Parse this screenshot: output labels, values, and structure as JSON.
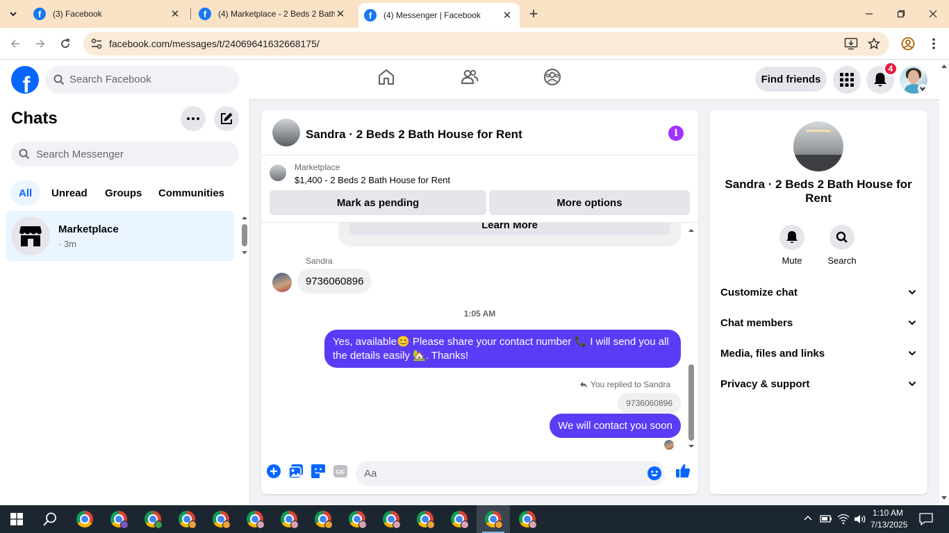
{
  "browser": {
    "tabs": [
      {
        "title": "(3) Facebook",
        "active": false
      },
      {
        "title": "(4) Marketplace - 2 Beds 2 Bath",
        "active": false
      },
      {
        "title": "(4) Messenger | Facebook",
        "active": true
      }
    ],
    "url": "facebook.com/messages/t/24069641632668175/"
  },
  "fb_header": {
    "logo": "f",
    "search_placeholder": "Search Facebook",
    "find_friends": "Find friends",
    "notifications_count": "4"
  },
  "chats": {
    "title": "Chats",
    "search_placeholder": "Search Messenger",
    "filters": [
      "All",
      "Unread",
      "Groups",
      "Communities"
    ],
    "active_filter": "All",
    "items": [
      {
        "name": "Marketplace",
        "time": "· 3m"
      }
    ]
  },
  "conversation": {
    "title": "Sandra · 2 Beds 2 Bath House for Rent",
    "marketplace_label": "Marketplace",
    "listing": "$1,400 - 2 Beds 2 Bath House for Rent",
    "mark_pending": "Mark as pending",
    "more_options": "More options",
    "learn_more": "Learn More",
    "messages": [
      {
        "sender": "Sandra",
        "text": "9736060896",
        "direction": "in"
      },
      {
        "timestamp": "1:05 AM"
      },
      {
        "text": "Yes, available😊 Please share your contact number 📞 I will send you all the details easily 🏡. Thanks!",
        "direction": "out"
      },
      {
        "reply_note": "You replied to Sandra",
        "quoted": "9736060896",
        "text": "We will contact you soon",
        "direction": "out"
      }
    ],
    "input_placeholder": "Aa"
  },
  "info_panel": {
    "name": "Sandra · 2 Beds 2 Bath House for Rent",
    "actions": [
      "Mute",
      "Search"
    ],
    "sections": [
      "Customize chat",
      "Chat members",
      "Media, files and links",
      "Privacy & support"
    ]
  },
  "taskbar": {
    "time": "1:10 AM",
    "date": "7/13/2025"
  },
  "colors": {
    "fb_blue": "#0866ff",
    "outgoing_bubble": "#5b3bf5",
    "info_purple": "#a033ff",
    "tab_bar": "#fae2c7"
  }
}
